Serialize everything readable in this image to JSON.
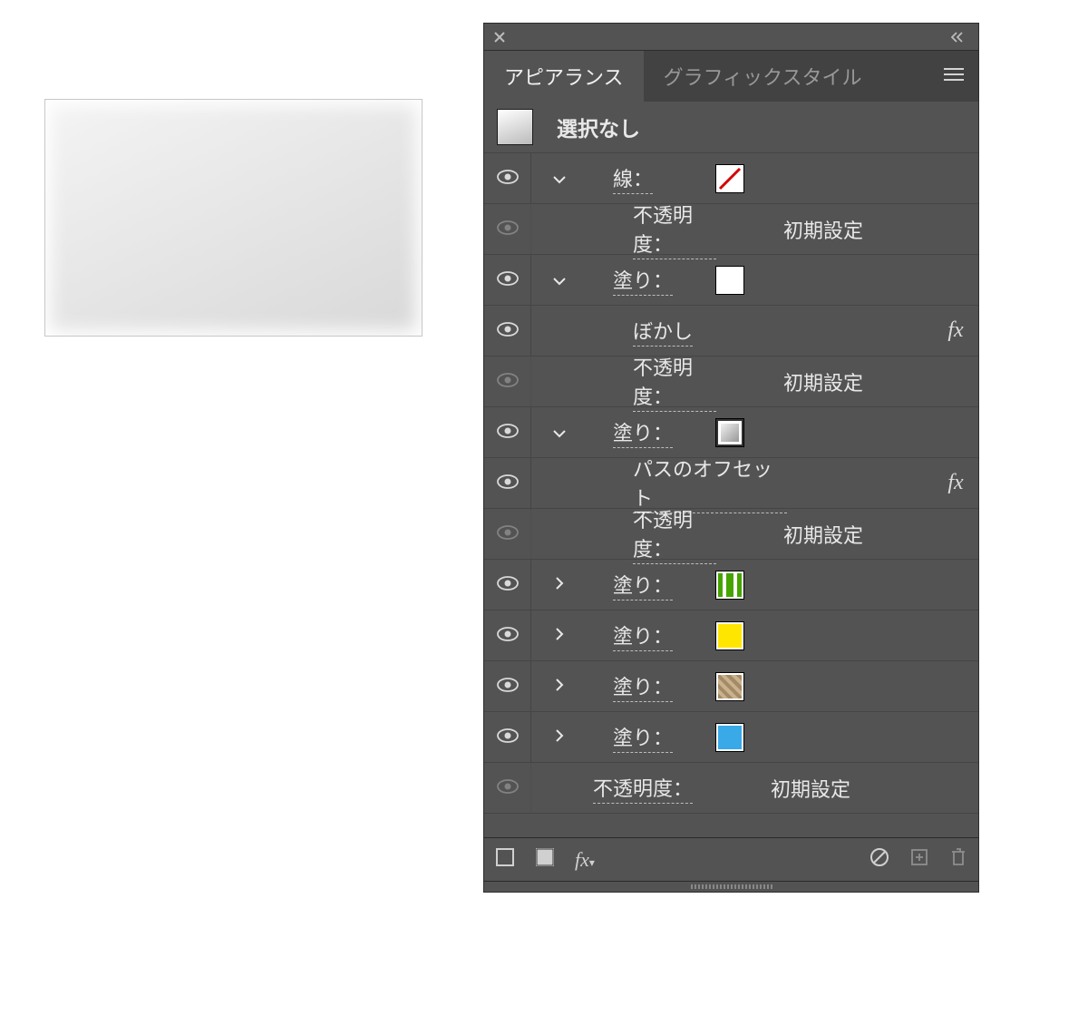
{
  "tabs": {
    "appearance": "アピアランス",
    "graphic_styles": "グラフィックスタイル"
  },
  "selection_label": "選択なし",
  "labels": {
    "stroke": "線：",
    "fill": "塗り：",
    "opacity": "不透明度：",
    "blur": "ぼかし",
    "offset_path": "パスのオフセット"
  },
  "values": {
    "default": "初期設定"
  },
  "fx": "fx",
  "swatches": {
    "none": "none",
    "white_grad": "#ffffff",
    "silver_grad": "linear-gradient(135deg,#fff,#999)",
    "green_pattern": "#59b100",
    "yellow": "#ffe600",
    "brown_pattern": "#9a7a55",
    "blue": "#3aa9e8"
  }
}
